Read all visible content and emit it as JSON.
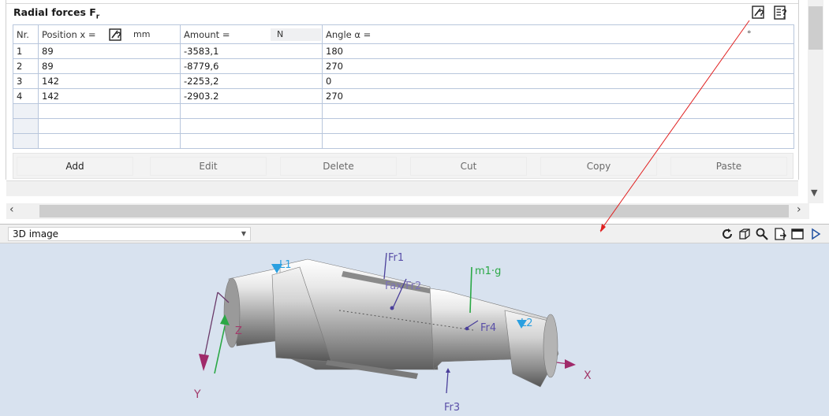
{
  "section": {
    "title": "Radial forces F",
    "title_sub": "r"
  },
  "table": {
    "headers": {
      "nr": "Nr.",
      "position": "Position x =",
      "position_unit": "mm",
      "amount": "Amount =",
      "amount_unit": "N",
      "angle": "Angle α =",
      "angle_unit": "°"
    },
    "rows": [
      {
        "nr": "1",
        "position": "89",
        "amount": "-3583,1",
        "angle": "180"
      },
      {
        "nr": "2",
        "position": "89",
        "amount": "-8779,6",
        "angle": "270"
      },
      {
        "nr": "3",
        "position": "142",
        "amount": "-2253,2",
        "angle": "0"
      },
      {
        "nr": "4",
        "position": "142",
        "amount": "-2903.2",
        "angle": "270"
      }
    ]
  },
  "buttons": {
    "add": "Add",
    "edit": "Edit",
    "delete": "Delete",
    "cut": "Cut",
    "copy": "Copy",
    "paste": "Paste"
  },
  "view": {
    "selected": "3D image"
  },
  "scene_labels": {
    "fr1": "Fr1",
    "fax_fr2": "Fax Fr2",
    "fr3": "Fr3",
    "fr4": "Fr4",
    "m1g": "m1·g",
    "l1": "L1",
    "l2": "L2",
    "axis_x": "X",
    "axis_y": "Y",
    "axis_z": "Z"
  },
  "colors": {
    "force_label": "#5a4fa8",
    "gravity": "#2aa845",
    "bearing": "#2a9fe0",
    "axis": "#a23a6a",
    "annotation_arrow": "#e02020"
  }
}
